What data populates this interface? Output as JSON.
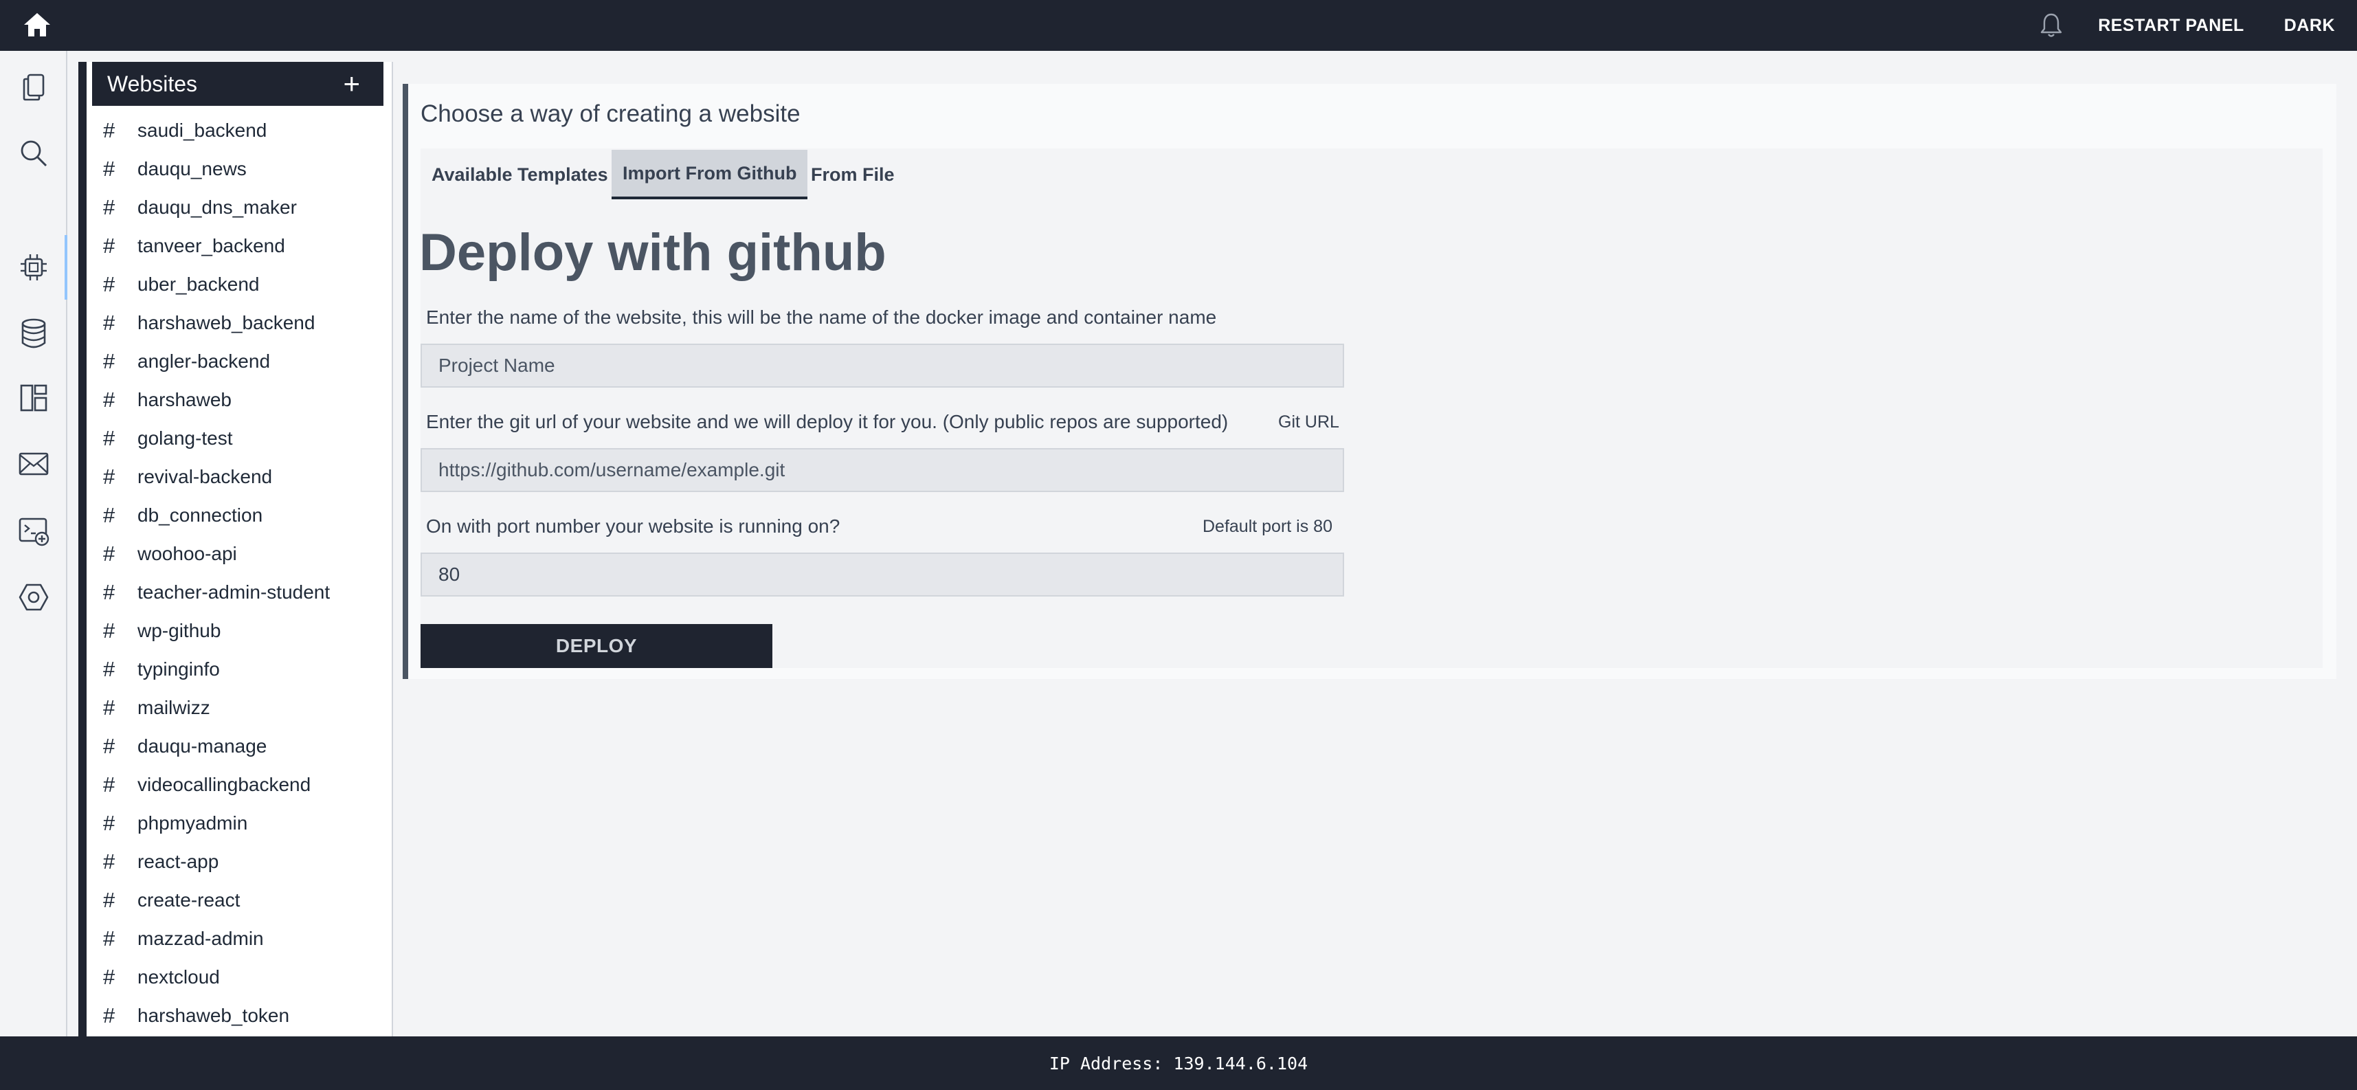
{
  "topbar": {
    "home_icon": "home-icon",
    "bell_icon": "bell-icon",
    "restart_label": "RESTART PANEL",
    "theme_label": "DARK"
  },
  "rail": {
    "icons": [
      "documents-icon",
      "search-icon",
      "chip-icon",
      "database-icon",
      "layout-icon",
      "mail-icon",
      "terminal-add-icon",
      "settings-hex-icon"
    ]
  },
  "sidebar": {
    "title": "Websites",
    "add_label": "+",
    "hash": "#",
    "items": [
      {
        "label": "saudi_backend"
      },
      {
        "label": "dauqu_news"
      },
      {
        "label": "dauqu_dns_maker"
      },
      {
        "label": "tanveer_backend"
      },
      {
        "label": "uber_backend"
      },
      {
        "label": "harshaweb_backend"
      },
      {
        "label": "angler-backend"
      },
      {
        "label": "harshaweb"
      },
      {
        "label": "golang-test"
      },
      {
        "label": "revival-backend"
      },
      {
        "label": "db_connection"
      },
      {
        "label": "woohoo-api"
      },
      {
        "label": "teacher-admin-student"
      },
      {
        "label": "wp-github"
      },
      {
        "label": "typinginfo"
      },
      {
        "label": "mailwizz"
      },
      {
        "label": "dauqu-manage"
      },
      {
        "label": "videocallingbackend"
      },
      {
        "label": "phpmyadmin"
      },
      {
        "label": "react-app"
      },
      {
        "label": "create-react"
      },
      {
        "label": "mazzad-admin"
      },
      {
        "label": "nextcloud"
      },
      {
        "label": "harshaweb_token"
      }
    ]
  },
  "main": {
    "title": "Choose a way of creating a website",
    "tabs": [
      {
        "label": "Available Templates"
      },
      {
        "label": "Import From Github"
      },
      {
        "label": "From File"
      }
    ],
    "active_tab": "Import From Github",
    "heading": "Deploy with github",
    "name_label": "Enter the name of the website, this will be the name of the docker image and container name",
    "name_placeholder": "Project Name",
    "git_label": "Enter the git url of your website and we will deploy it for you. (Only public repos are supported)",
    "git_hint": "Git URL",
    "git_placeholder": "https://github.com/username/example.git",
    "port_label": "On with port number your website is running on?",
    "port_hint": "Default port is 80",
    "port_value": "80",
    "deploy_label": "DEPLOY"
  },
  "footer": {
    "ip_text": "IP Address: 139.144.6.104"
  }
}
